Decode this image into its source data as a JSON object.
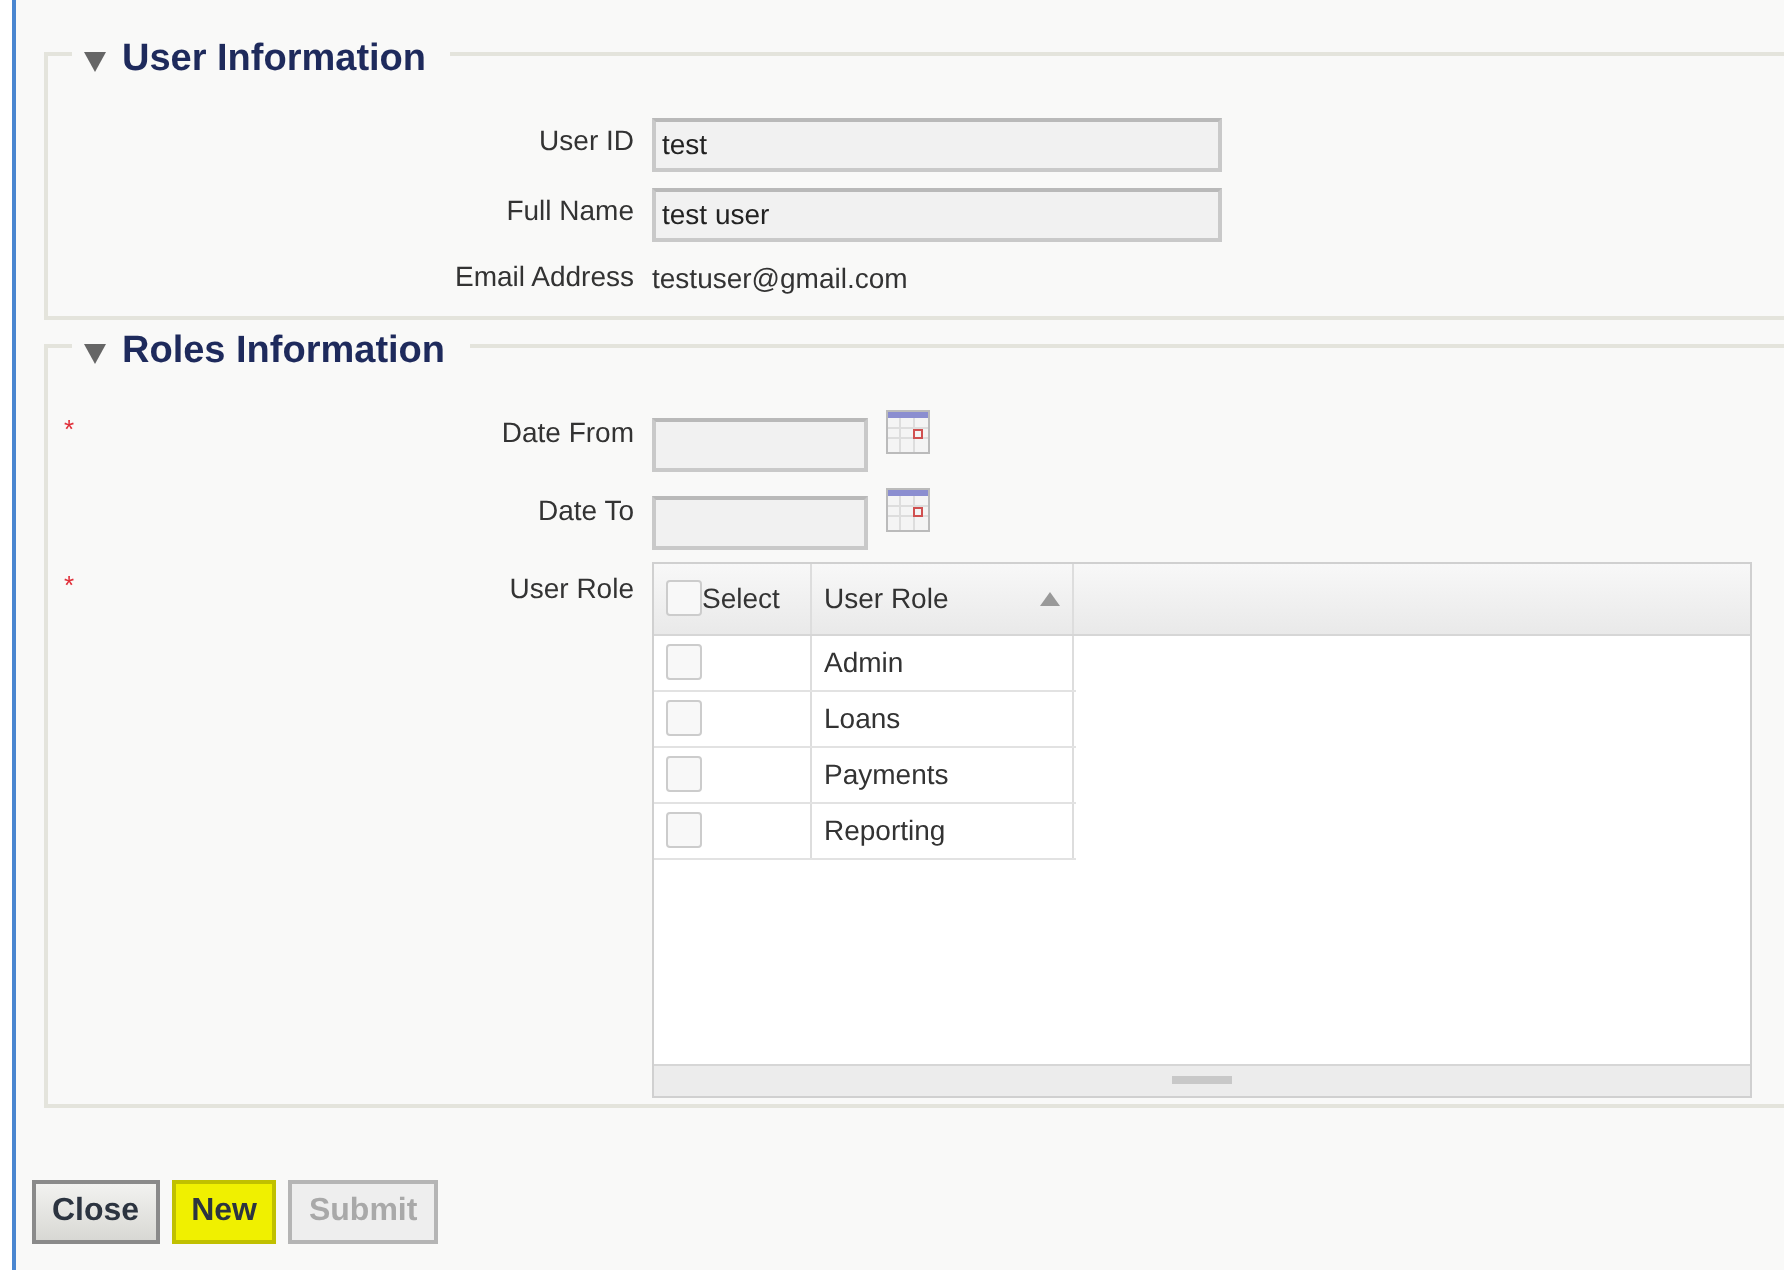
{
  "sections": [
    {
      "title": "User Information",
      "expanded": true,
      "fields": [
        {
          "kind": "text",
          "label": "User ID",
          "value": "test"
        },
        {
          "kind": "text",
          "label": "Full Name",
          "value": "test user"
        },
        {
          "kind": "static",
          "label": "Email Address",
          "value": "testuser@gmail.com"
        }
      ]
    },
    {
      "title": "Roles Information",
      "expanded": true,
      "fields": [
        {
          "kind": "date",
          "label": "Date From",
          "required_mark": "*"
        },
        {
          "kind": "date",
          "label": "Date To"
        },
        {
          "kind": "grid",
          "label": "User Role",
          "required_mark": "*",
          "grid": {
            "select_header": "Select",
            "all_checked": false,
            "role_header": "User Role",
            "sort_ascending": true,
            "rows": [
              {
                "role": "Admin",
                "checked": false
              },
              {
                "role": "Loans",
                "checked": false
              },
              {
                "role": "Payments",
                "checked": false
              },
              {
                "role": "Reporting",
                "checked": false
              }
            ]
          }
        }
      ]
    }
  ],
  "buttons": [
    {
      "label": "Close",
      "highlighted": false,
      "disabled": false
    },
    {
      "label": "New",
      "highlighted": true,
      "disabled": false
    },
    {
      "label": "Submit",
      "highlighted": false,
      "disabled": true
    }
  ]
}
